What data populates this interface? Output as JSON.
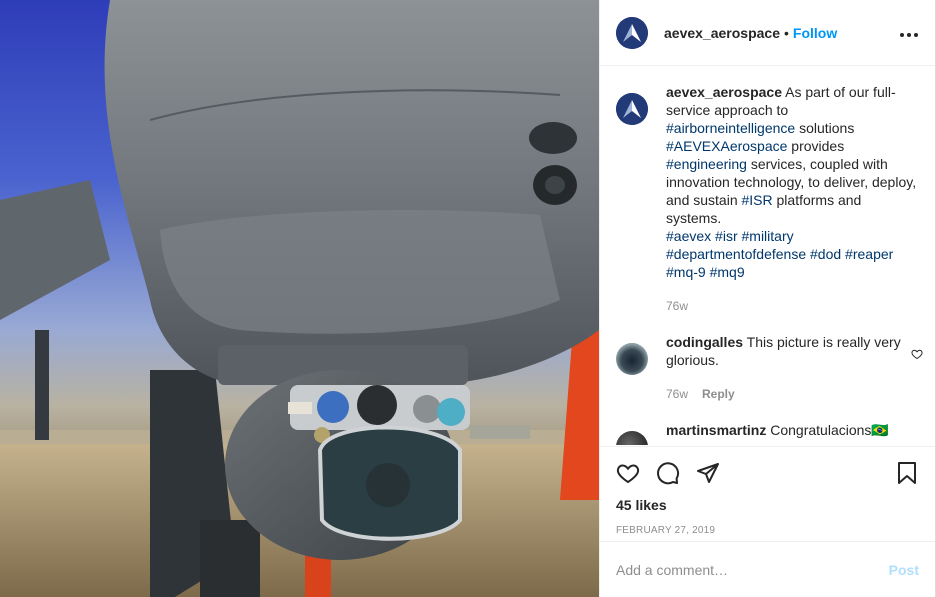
{
  "post": {
    "image_alt": "Drone sensor turret"
  },
  "header": {
    "username": "aevex_aerospace",
    "separator": "•",
    "follow_label": "Follow",
    "more_icon": "more-options-icon"
  },
  "caption": {
    "username": "aevex_aerospace",
    "parts": [
      {
        "t": "As part of our full-service approach to "
      },
      {
        "t": "#airborneintelligence",
        "tag": true
      },
      {
        "t": " solutions "
      },
      {
        "t": "#AEVEXAerospace",
        "tag": true
      },
      {
        "t": " provides "
      },
      {
        "t": "#engineering",
        "tag": true
      },
      {
        "t": " services, coupled with innovation technology, to deliver, deploy, and sustain "
      },
      {
        "t": "#ISR",
        "tag": true
      },
      {
        "t": " platforms and systems."
      }
    ],
    "hashtags": [
      "#aevex",
      "#isr",
      "#military",
      "#departmentofdefense",
      "#dod",
      "#reaper",
      "#mq-9",
      "#mq9"
    ],
    "age": "76w"
  },
  "comments": [
    {
      "username": "codingalles",
      "text": "This picture is really very glorious.",
      "age": "76w",
      "reply_label": "Reply"
    },
    {
      "username": "martinsmartinz",
      "text": "Congratulacions🇧🇷"
    }
  ],
  "actions": {
    "likes": "45 likes",
    "date": "FEBRUARY 27, 2019"
  },
  "add_comment": {
    "placeholder": "Add a comment…",
    "post_label": "Post"
  },
  "colors": {
    "link": "#0095f6",
    "hashtag": "#00376b",
    "muted": "#8e8e8e",
    "post_disabled": "#b2dffc"
  }
}
